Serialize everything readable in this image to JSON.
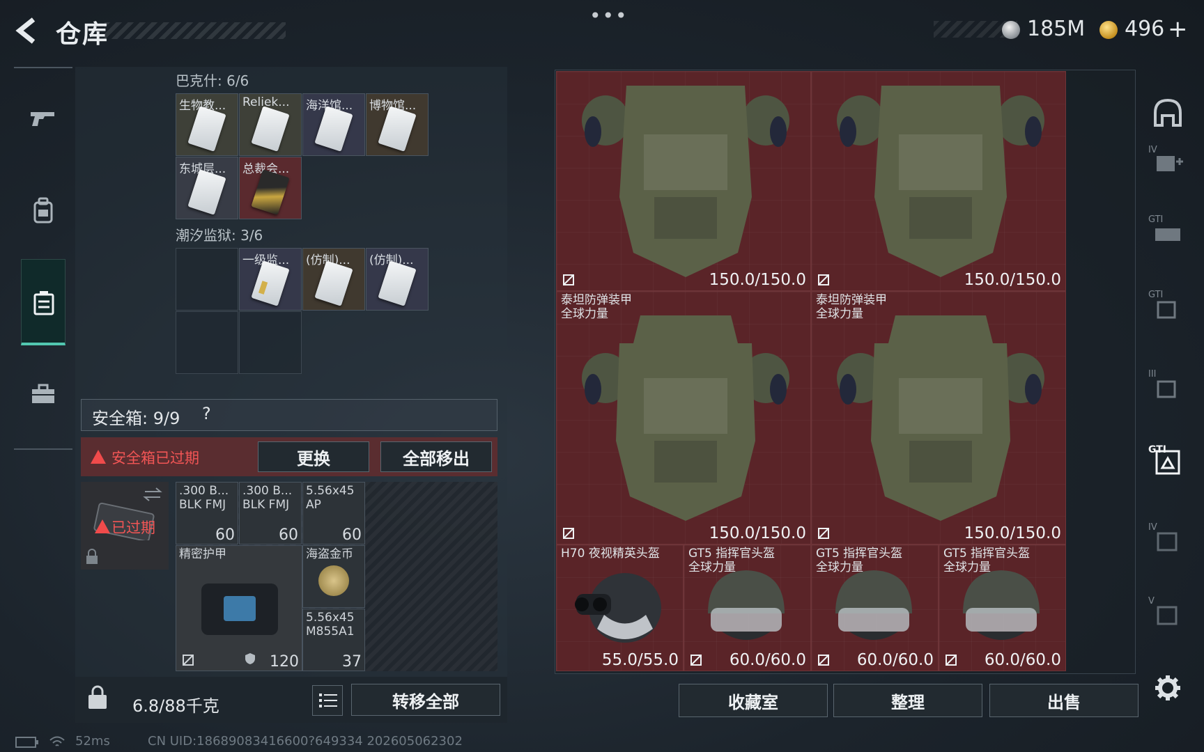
{
  "header": {
    "title": "仓库",
    "more_dots": "•••",
    "currency_silver": "185M",
    "currency_gold": "496",
    "gold_plus": "+"
  },
  "left_nav": {
    "items": [
      {
        "name": "weapons",
        "icon": "gun-icon"
      },
      {
        "name": "backpack",
        "icon": "backpack-icon"
      },
      {
        "name": "collection",
        "icon": "case-icon",
        "active": true
      },
      {
        "name": "toolbox",
        "icon": "toolbox-icon"
      }
    ]
  },
  "collections": {
    "bakshi": {
      "label": "巴克什: 6/6",
      "items": [
        "生物教...",
        "Reliek...",
        "海洋馆...",
        "博物馆...",
        "东城层...",
        "总裁会..."
      ]
    },
    "tide_prison": {
      "label": "潮汐监狱: 3/6",
      "items": [
        "一级监...",
        "(仿制)...",
        "(仿制)..."
      ]
    }
  },
  "safebox": {
    "label": "安全箱: 9/9",
    "help": "?",
    "expired_notice": "安全箱已过期",
    "replace_button": "更换",
    "remove_all_button": "全部移出",
    "case_status": "已过期",
    "ammo": [
      {
        "label": ".300 B...\nBLK FMJ",
        "count": "60"
      },
      {
        "label": ".300 B...\nBLK FMJ",
        "count": "60"
      },
      {
        "label": "5.56x45\nAP",
        "count": "60"
      }
    ],
    "armor_label": "精密护甲",
    "armor_value": "120",
    "coin_label": "海盗金币",
    "ammo2_label": "5.56x45\nM855A1",
    "ammo2_count": "37"
  },
  "footer_left": {
    "weight": "6.8/88千克",
    "transfer_all": "转移全部"
  },
  "inventory": {
    "vests": [
      {
        "name": "",
        "durability": "150.0/150.0"
      },
      {
        "name": "",
        "durability": "150.0/150.0"
      },
      {
        "name": "泰坦防弹装甲\n全球力量",
        "durability": "150.0/150.0"
      },
      {
        "name": "泰坦防弹装甲\n全球力量",
        "durability": "150.0/150.0"
      }
    ],
    "helmets": [
      {
        "name": "H70 夜视精英头盔",
        "durability": "55.0/55.0"
      },
      {
        "name": "GT5 指挥官头盔\n全球力量",
        "durability": "60.0/60.0"
      },
      {
        "name": "GT5 指挥官头盔\n全球力量",
        "durability": "60.0/60.0"
      },
      {
        "name": "GT5 指挥官头盔\n全球力量",
        "durability": "60.0/60.0"
      }
    ]
  },
  "footer_right": {
    "collection_room": "收藏室",
    "organize": "整理",
    "sell": "出售"
  },
  "right_nav": {
    "labels": [
      "",
      "IV",
      "GTI",
      "GTI",
      "III",
      "GTI",
      "IV",
      "V"
    ]
  },
  "status": {
    "ping": "52ms",
    "uid": "CN UID:18689083416600?649334 202605062302"
  },
  "colors": {
    "accent_teal": "#52c7b0",
    "warning_red": "#f25555",
    "item_bg_red": "#5a2428"
  }
}
